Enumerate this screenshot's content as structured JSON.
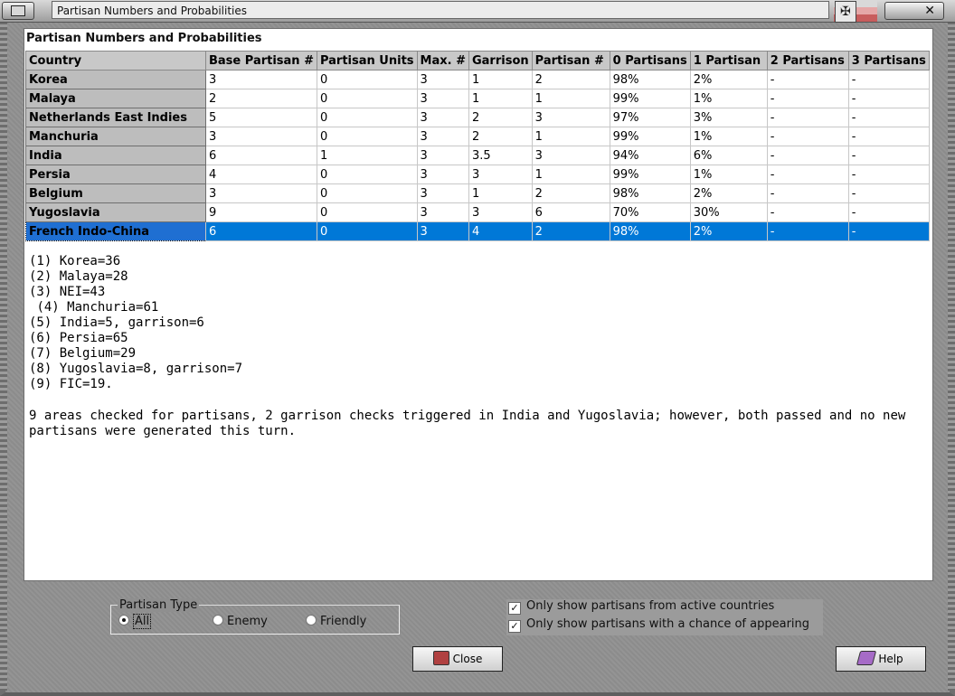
{
  "window": {
    "title": "Partisan Numbers and Probabilities",
    "flag_icon": "flag-icon",
    "close_icon": "close-icon"
  },
  "panel": {
    "title": "Partisan Numbers and Probabilities",
    "columns": [
      "Country",
      "Base Partisan #",
      "Partisan Units",
      "Max. #",
      "Garrison",
      "Partisan #",
      "0 Partisans",
      "1 Partisan",
      "2 Partisans",
      "3 Partisans"
    ],
    "rows": [
      [
        "Korea",
        "3",
        "0",
        "3",
        "1",
        "2",
        "98%",
        "2%",
        "-",
        "-"
      ],
      [
        "Malaya",
        "2",
        "0",
        "3",
        "1",
        "1",
        "99%",
        "1%",
        "-",
        "-"
      ],
      [
        "Netherlands East Indies",
        "5",
        "0",
        "3",
        "2",
        "3",
        "97%",
        "3%",
        "-",
        "-"
      ],
      [
        "Manchuria",
        "3",
        "0",
        "3",
        "2",
        "1",
        "99%",
        "1%",
        "-",
        "-"
      ],
      [
        "India",
        "6",
        "1",
        "3",
        "3.5",
        "3",
        "94%",
        "6%",
        "-",
        "-"
      ],
      [
        "Persia",
        "4",
        "0",
        "3",
        "3",
        "1",
        "99%",
        "1%",
        "-",
        "-"
      ],
      [
        "Belgium",
        "3",
        "0",
        "3",
        "1",
        "2",
        "98%",
        "2%",
        "-",
        "-"
      ],
      [
        "Yugoslavia",
        "9",
        "0",
        "3",
        "3",
        "6",
        "70%",
        "30%",
        "-",
        "-"
      ],
      [
        "French Indo-China",
        "6",
        "0",
        "3",
        "4",
        "2",
        "98%",
        "2%",
        "-",
        "-"
      ]
    ],
    "selected_row": 8,
    "notes": "(1) Korea=36\n(2) Malaya=28\n(3) NEI=43\n (4) Manchuria=61\n(5) India=5, garrison=6\n(6) Persia=65\n(7) Belgium=29\n(8) Yugoslavia=8, garrison=7\n(9) FIC=19.",
    "summary": "9 areas checked for partisans, 2 garrison checks triggered in India and Yugoslavia; however, both passed and no new partisans were generated this turn."
  },
  "filters": {
    "partisan_type_label": "Partisan Type",
    "options": [
      "All",
      "Enemy",
      "Friendly"
    ],
    "selected_option": "All",
    "only_active_label": "Only show partisans from active countries",
    "only_chance_label": "Only show partisans with a chance of appearing"
  },
  "buttons": {
    "close_label": "Close",
    "help_label": "Help"
  },
  "colors": {
    "selection": "#0078d7",
    "country_cell": "#bdbdbd"
  }
}
